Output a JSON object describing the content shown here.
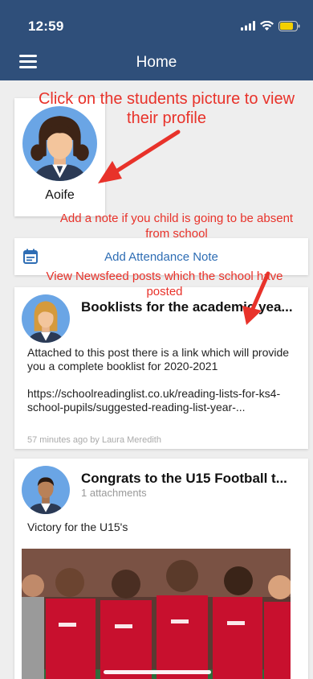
{
  "status_bar": {
    "time": "12:59"
  },
  "header": {
    "title": "Home",
    "menu_icon": "hamburger-menu-icon"
  },
  "student": {
    "name": "Aoife",
    "avatar_icon": "student-girl-avatar-icon"
  },
  "attendance": {
    "label": "Add Attendance Note",
    "icon": "calendar-icon"
  },
  "annotations": {
    "profile_hint": "Click on the students picture to view their profile",
    "absent_hint": "Add a note if you child is going to be absent from school",
    "newsfeed_hint": "View Newsfeed posts which the school have posted"
  },
  "posts": [
    {
      "title": "Booklists for the academic yea...",
      "body": "Attached to this post there is a link which will provide you a complete booklist for 2020-2021",
      "link": "https://schoolreadinglist.co.uk/reading-lists-for-ks4-school-pupils/suggested-reading-list-year-...",
      "meta": "57 minutes ago by Laura Meredith",
      "avatar_icon": "teacher-woman-avatar-icon"
    },
    {
      "title": "Congrats to the U15 Football t...",
      "subtitle": "1 attachments",
      "body": "Victory for the U15's",
      "avatar_icon": "teacher-man-avatar-icon",
      "image": "football-team-photo"
    }
  ],
  "colors": {
    "header": "#2f4f7a",
    "accent": "#2e6db4",
    "annotation": "#e8322a"
  }
}
